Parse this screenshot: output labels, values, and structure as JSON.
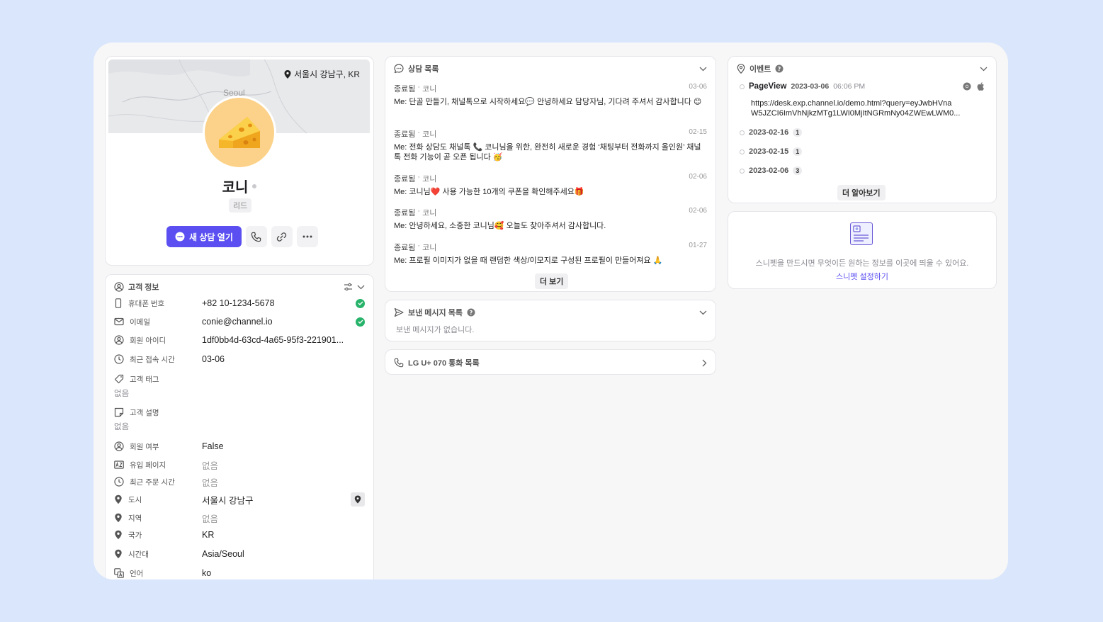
{
  "profile": {
    "map_location": "서울시 강남구, KR",
    "map_city": "Seoul",
    "name": "코니",
    "tag": "리드",
    "new_chat_label": "새 상담 열기"
  },
  "customer_info": {
    "title": "고객 정보",
    "fields": [
      {
        "label": "휴대폰 번호",
        "value": "+82 10-1234-5678"
      },
      {
        "label": "이메일",
        "value": "conie@channel.io"
      },
      {
        "label": "회원 아이디",
        "value": "1df0bb4d-63cd-4a65-95f3-221901..."
      },
      {
        "label": "최근 접속 시간",
        "value": "03-06"
      },
      {
        "label": "고객 태그",
        "value": "없음"
      },
      {
        "label": "고객 설명",
        "value": "없음"
      },
      {
        "label": "회원 여부",
        "value": "False"
      },
      {
        "label": "유입 페이지",
        "value": "없음"
      },
      {
        "label": "최근 주문 시간",
        "value": "없음"
      },
      {
        "label": "도시",
        "value": "서울시 강남구"
      },
      {
        "label": "지역",
        "value": "없음"
      },
      {
        "label": "국가",
        "value": "KR"
      },
      {
        "label": "시간대",
        "value": "Asia/Seoul"
      },
      {
        "label": "언어",
        "value": "ko"
      }
    ]
  },
  "conversations": {
    "title": "상담 목록",
    "items": [
      {
        "status": "종료됨",
        "author": "코니",
        "date": "03-06",
        "message": "Me: 단골 만들기, 채널톡으로 시작하세요💬 안녕하세요 담당자님, 기다려 주셔서 감사합니다 😊"
      },
      {
        "status": "종료됨",
        "author": "코니",
        "date": "02-15",
        "message": "Me: 전화 상담도 채널톡 📞 코니님을 위한, 완전히 새로운 경험 ‘채팅부터 전화까지 올인원’ 채널톡 전화 기능이 곧 오픈 됩니다 🥳"
      },
      {
        "status": "종료됨",
        "author": "코니",
        "date": "02-06",
        "message": "Me: 코니님❤️ 사용 가능한 10개의 쿠폰을 확인해주세요🎁"
      },
      {
        "status": "종료됨",
        "author": "코니",
        "date": "02-06",
        "message": "Me: 안녕하세요, 소중한 코니님🥰 오늘도 찾아주셔서 감사합니다."
      },
      {
        "status": "종료됨",
        "author": "코니",
        "date": "01-27",
        "message": "Me: 프로필 이미지가 없을 때 랜덤한 색상/이모지로 구성된 프로필이 만들어져요 🙏"
      }
    ],
    "more_label": "더 보기"
  },
  "sent_messages": {
    "title": "보낸 메시지 목록",
    "empty": "보낸 메시지가 없습니다."
  },
  "calls": {
    "title": "LG U+ 070 통화 목록"
  },
  "events": {
    "title": "이벤트",
    "first": {
      "name": "PageView",
      "date": "2023-03-06",
      "time": "06:06 PM",
      "url_line1": "https://desk.exp.channel.io/demo.html?query=eyJwbHVna",
      "url_line2": "W5JZCI6ImVhNjkzMTg1LWI0MjItNGRmNy04ZWEwLWM0..."
    },
    "others": [
      {
        "date": "2023-02-16",
        "count": "1"
      },
      {
        "date": "2023-02-15",
        "count": "1"
      },
      {
        "date": "2023-02-06",
        "count": "3"
      }
    ],
    "more_label": "더 알아보기"
  },
  "snippet": {
    "description": "스니펫을 만드시면 무엇이든 원하는 정보를 이곳에 띄울 수 있어요.",
    "link": "스니펫 설정하기"
  },
  "colors": {
    "background": "#dae6fb",
    "primary": "#5b4ff1",
    "success": "#27b36a"
  }
}
